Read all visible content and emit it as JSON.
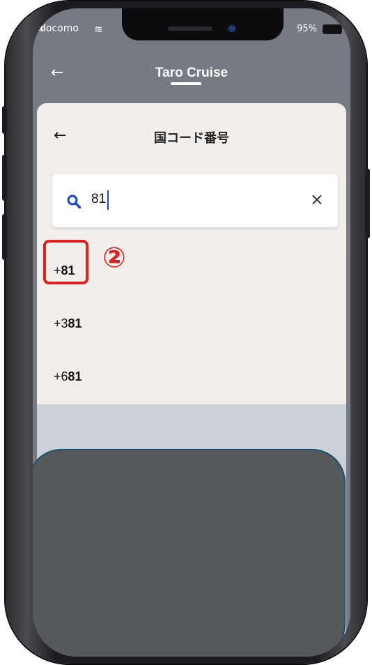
{
  "status_bar": {
    "carrier": "docomo",
    "battery": "95%"
  },
  "top_bar": {
    "back_icon": "←",
    "title": "Taro Cruise"
  },
  "sheet": {
    "back_icon": "←",
    "title": "国コード番号",
    "search": {
      "value": "81",
      "clear_icon": "×"
    },
    "results": [
      {
        "prefix": "+",
        "match": "81"
      },
      {
        "prefix": "+3",
        "match": "81"
      },
      {
        "prefix": "+6",
        "match": "81"
      }
    ]
  },
  "annotation": {
    "step": "②"
  },
  "colors": {
    "header_bg": "#767a83",
    "sheet_bg": "#f1eeec",
    "highlight": "#e0201f",
    "keyboard_bg": "#55595c"
  }
}
